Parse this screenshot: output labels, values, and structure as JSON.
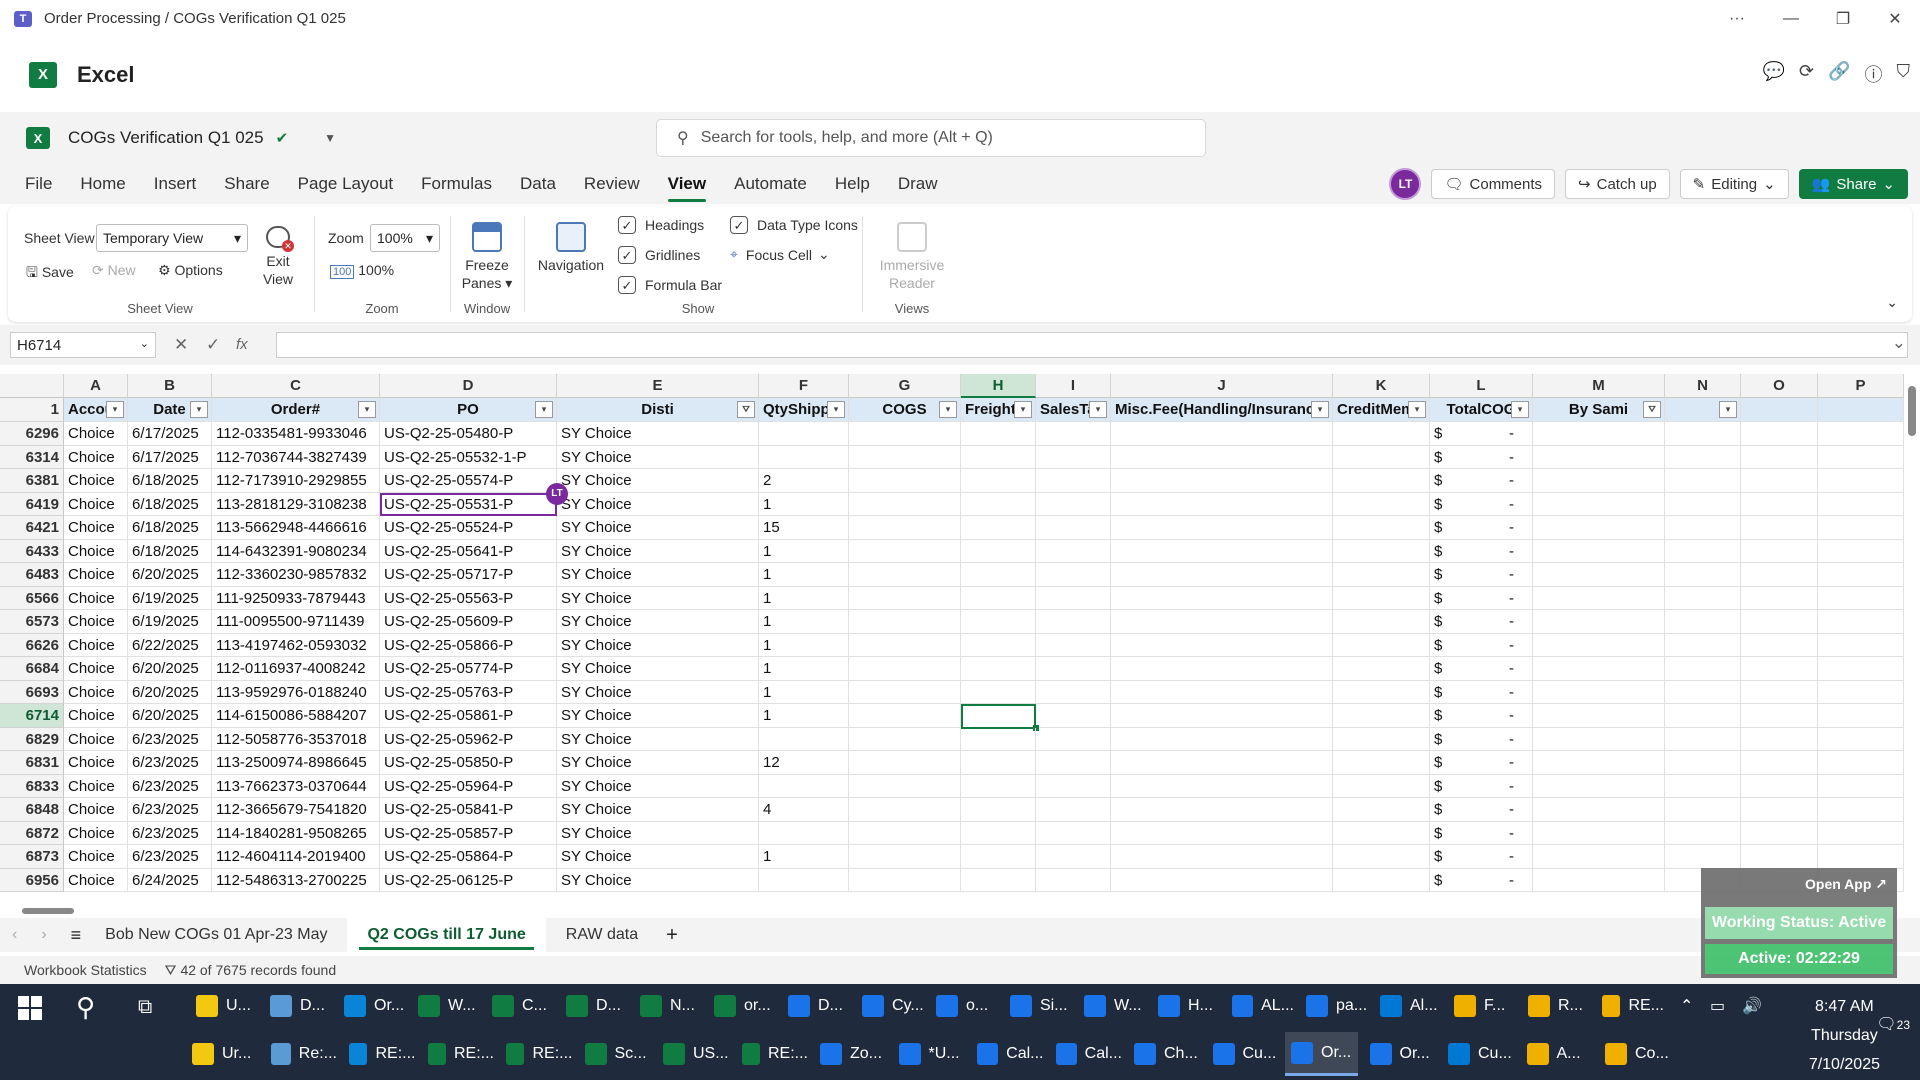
{
  "window": {
    "title": "Order Processing / COGs Verification Q1 025",
    "min": "—",
    "max": "❐",
    "close": "✕",
    "more": "···"
  },
  "app": {
    "name": "Excel",
    "logo_letter": "X"
  },
  "doc": {
    "name": "COGs Verification Q1 025",
    "search_placeholder": "Search for tools, help, and more (Alt + Q)"
  },
  "menu": [
    "File",
    "Home",
    "Insert",
    "Share",
    "Page Layout",
    "Formulas",
    "Data",
    "Review",
    "View",
    "Automate",
    "Help",
    "Draw"
  ],
  "active_menu": "View",
  "topright": {
    "avatar": "LT",
    "comments": "Comments",
    "catchup": "Catch up",
    "editing": "Editing",
    "share": "Share"
  },
  "ribbon": {
    "sheetview": {
      "label": "Sheet View",
      "value": "Temporary View",
      "save": "Save",
      "new": "New",
      "options": "Options",
      "exit": "Exit View",
      "group": "Sheet View"
    },
    "zoom": {
      "label": "Zoom",
      "value": "100%",
      "pct": "100%",
      "group": "Zoom"
    },
    "window": {
      "freeze": "Freeze Panes",
      "group": "Window"
    },
    "show": {
      "navigation": "Navigation",
      "headings": "Headings",
      "gridlines": "Gridlines",
      "formula_bar": "Formula Bar",
      "data_type_icons": "Data Type Icons",
      "focus_cell": "Focus Cell",
      "group": "Show"
    },
    "views": {
      "immersive": "Immersive Reader",
      "group": "Views"
    }
  },
  "formula": {
    "namebox": "H6714",
    "value": "",
    "fx": "fx"
  },
  "columns": [
    "A",
    "B",
    "C",
    "D",
    "E",
    "F",
    "G",
    "H",
    "I",
    "J",
    "K",
    "L",
    "M",
    "N",
    "O",
    "P"
  ],
  "selected_column": "H",
  "header_row": {
    "num": "1",
    "cells": [
      "Accou",
      "Date",
      "Order#",
      "PO",
      "Disti",
      "QtyShipp",
      "COGS",
      "Freight",
      "SalesTa",
      "Misc.Fee(Handling/Insuranc",
      "CreditMem",
      "TotalCOG",
      "By Sami",
      "",
      "",
      ""
    ]
  },
  "rows": [
    {
      "num": "6296",
      "a": "Choice",
      "b": "6/17/2025",
      "c": "112-0335481-9933046",
      "d": "US-Q2-25-05480-P",
      "e": "SY Choice",
      "f": ""
    },
    {
      "num": "6314",
      "a": "Choice",
      "b": "6/17/2025",
      "c": "112-7036744-3827439",
      "d": "US-Q2-25-05532-1-P",
      "e": "SY Choice",
      "f": ""
    },
    {
      "num": "6381",
      "a": "Choice",
      "b": "6/18/2025",
      "c": "112-7173910-2929855",
      "d": "US-Q2-25-05574-P",
      "e": "SY Choice",
      "f": "2"
    },
    {
      "num": "6419",
      "a": "Choice",
      "b": "6/18/2025",
      "c": "113-2818129-3108238",
      "d": "US-Q2-25-05531-P",
      "e": "SY Choice",
      "f": "1"
    },
    {
      "num": "6421",
      "a": "Choice",
      "b": "6/18/2025",
      "c": "113-5662948-4466616",
      "d": "US-Q2-25-05524-P",
      "e": "SY Choice",
      "f": "15"
    },
    {
      "num": "6433",
      "a": "Choice",
      "b": "6/18/2025",
      "c": "114-6432391-9080234",
      "d": "US-Q2-25-05641-P",
      "e": "SY Choice",
      "f": "1"
    },
    {
      "num": "6483",
      "a": "Choice",
      "b": "6/20/2025",
      "c": "112-3360230-9857832",
      "d": "US-Q2-25-05717-P",
      "e": "SY Choice",
      "f": "1"
    },
    {
      "num": "6566",
      "a": "Choice",
      "b": "6/19/2025",
      "c": "111-9250933-7879443",
      "d": "US-Q2-25-05563-P",
      "e": "SY Choice",
      "f": "1"
    },
    {
      "num": "6573",
      "a": "Choice",
      "b": "6/19/2025",
      "c": "111-0095500-9711439",
      "d": "US-Q2-25-05609-P",
      "e": "SY Choice",
      "f": "1"
    },
    {
      "num": "6626",
      "a": "Choice",
      "b": "6/22/2025",
      "c": "113-4197462-0593032",
      "d": "US-Q2-25-05866-P",
      "e": "SY Choice",
      "f": "1"
    },
    {
      "num": "6684",
      "a": "Choice",
      "b": "6/20/2025",
      "c": "112-0116937-4008242",
      "d": "US-Q2-25-05774-P",
      "e": "SY Choice",
      "f": "1"
    },
    {
      "num": "6693",
      "a": "Choice",
      "b": "6/20/2025",
      "c": "113-9592976-0188240",
      "d": "US-Q2-25-05763-P",
      "e": "SY Choice",
      "f": "1"
    },
    {
      "num": "6714",
      "a": "Choice",
      "b": "6/20/2025",
      "c": "114-6150086-5884207",
      "d": "US-Q2-25-05861-P",
      "e": "SY Choice",
      "f": "1"
    },
    {
      "num": "6829",
      "a": "Choice",
      "b": "6/23/2025",
      "c": "112-5058776-3537018",
      "d": "US-Q2-25-05962-P",
      "e": "SY Choice",
      "f": ""
    },
    {
      "num": "6831",
      "a": "Choice",
      "b": "6/23/2025",
      "c": "113-2500974-8986645",
      "d": "US-Q2-25-05850-P",
      "e": "SY Choice",
      "f": "12"
    },
    {
      "num": "6833",
      "a": "Choice",
      "b": "6/23/2025",
      "c": "113-7662373-0370644",
      "d": "US-Q2-25-05964-P",
      "e": "SY Choice",
      "f": ""
    },
    {
      "num": "6848",
      "a": "Choice",
      "b": "6/23/2025",
      "c": "112-3665679-7541820",
      "d": "US-Q2-25-05841-P",
      "e": "SY Choice",
      "f": "4"
    },
    {
      "num": "6872",
      "a": "Choice",
      "b": "6/23/2025",
      "c": "114-1840281-9508265",
      "d": "US-Q2-25-05857-P",
      "e": "SY Choice",
      "f": ""
    },
    {
      "num": "6873",
      "a": "Choice",
      "b": "6/23/2025",
      "c": "112-4604114-2019400",
      "d": "US-Q2-25-05864-P",
      "e": "SY Choice",
      "f": "1"
    },
    {
      "num": "6956",
      "a": "Choice",
      "b": "6/24/2025",
      "c": "112-5486313-2700225",
      "d": "US-Q2-25-06125-P",
      "e": "SY Choice",
      "f": ""
    }
  ],
  "total_cogs": {
    "currency": "$",
    "value": "-"
  },
  "selected_row": "6714",
  "collab_row": "6419",
  "collab_badge": "LT",
  "sheets": [
    "Bob New COGs 01 Apr-23 May",
    "Q2 COGs till 17 June",
    "RAW data"
  ],
  "active_sheet": "Q2 COGs till 17 June",
  "status": {
    "workbook": "Workbook Statistics",
    "filter": "42 of 7675 records found"
  },
  "popup": {
    "open": "Open App ↗",
    "working": "Working Status: Active",
    "active": "Active: 02:22:29"
  },
  "taskbar": {
    "row1": [
      "U...",
      "D...",
      "Or...",
      "W...",
      "C...",
      "D...",
      "N...",
      "or...",
      "D...",
      "Cy...",
      "o...",
      "Si...",
      "W...",
      "H...",
      "AL...",
      "pa...",
      "Al...",
      "F...",
      "R...",
      "RE..."
    ],
    "row2": [
      "Ur...",
      "Re:...",
      "RE:...",
      "RE:...",
      "RE:...",
      "Sc...",
      "US...",
      "RE:...",
      "Zo...",
      "*U...",
      "Cal...",
      "Cal...",
      "Ch...",
      "Cu...",
      "Or...",
      "Or...",
      "Cu...",
      "A...",
      "Co..."
    ],
    "time": "8:47 AM",
    "day": "Thursday",
    "date": "7/10/2025",
    "notif": "23"
  },
  "colors": {
    "excel_green": "#107c41",
    "header_fill": "#dbe8f5",
    "collab": "#7b2a9e",
    "taskbar": "#1f2a3c"
  }
}
